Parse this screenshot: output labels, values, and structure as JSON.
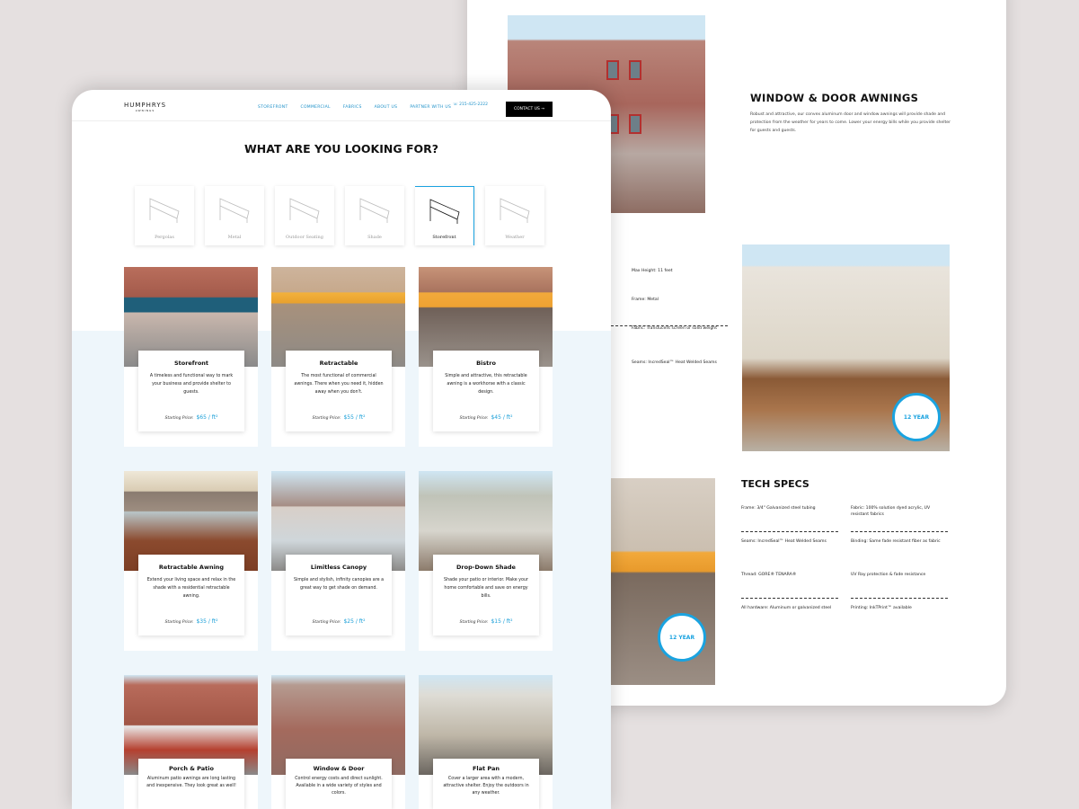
{
  "front": {
    "logo": {
      "name": "HUMPHRYS",
      "sub": "AWNINGS"
    },
    "nav": [
      "STOREFRONT",
      "COMMERCIAL",
      "FABRICS",
      "ABOUT US",
      "PARTNER WITH US"
    ],
    "phone": "215-425-2222",
    "cta": "CONTACT US →",
    "heading": "WHAT ARE YOU LOOKING FOR?",
    "tiles": [
      "Pergolas",
      "Metal",
      "Outdoor Seating",
      "Shade",
      "Storefront",
      "Weather"
    ],
    "active_tile": "Storefront",
    "price_label": "Starting Price:",
    "cards": [
      {
        "title": "Storefront",
        "desc": "A timeless and functional way to mark your business and provide shelter to guests.",
        "price": "$65 / ft²"
      },
      {
        "title": "Retractable",
        "desc": "The most functional of commercial awnings. There when you need it, hidden away when you don't.",
        "price": "$55 / ft²"
      },
      {
        "title": "Bistro",
        "desc": "Simple and attractive, this retractable awning is a workhorse with a classic design.",
        "price": "$45 / ft²"
      },
      {
        "title": "Retractable Awning",
        "desc": "Extend your living space and relax in the shade with a residential retractable awning.",
        "price": "$35 / ft²"
      },
      {
        "title": "Limitless Canopy",
        "desc": "Simple and stylish, infinity canopies are a great way to get shade on demand.",
        "price": "$25 / ft²"
      },
      {
        "title": "Drop-Down Shade",
        "desc": "Shade your patio or interior. Make your home comfortable and save on energy bills.",
        "price": "$15 / ft²"
      },
      {
        "title": "Porch & Patio",
        "desc": "Aluminum patio awnings are long lasting and inexpensive. They look great as well!",
        "price": ""
      },
      {
        "title": "Window & Door",
        "desc": "Control energy costs and direct sunlight. Available in a wide variety of styles and colors.",
        "price": ""
      },
      {
        "title": "Flat Pan",
        "desc": "Cover a larger area with a modern, attractive shelter. Enjoy the outdoors in any weather.",
        "price": ""
      }
    ]
  },
  "back": {
    "title": "WINDOW & DOOR AWNINGS",
    "desc": "Robust and attractive, our convex aluminum door and window awnings will provide shade and protection from the weather for years to come. Lower your energy bills while you provide shelter for guests and guests.",
    "specs": [
      "Max Height: 11 feet",
      "Frame: Metal",
      "Fabric: Translucent screen or solid weight",
      "Seams: IncredSeal™ Heat Welded Seams"
    ],
    "tech_title": "TECH SPECS",
    "tech": [
      "Frame: 3/4\" Galvanized steel tubing",
      "Fabric: 100% solution dyed acrylic, UV resistant fabrics",
      "Seams: IncredSeal™ Heat Welded Seams",
      "Binding: Same fade resistant fiber as fabric",
      "Thread: GORE® TENARA®",
      "UV Ray protection & fade resistance",
      "All hardware: Aluminum or galvanized steel",
      "Printing: InkTPrint™ available"
    ],
    "badge": "12 YEAR"
  },
  "colors": {
    "accent": "#1aa3e0",
    "band": "#eef6fb",
    "background": "#e5e0e0"
  }
}
